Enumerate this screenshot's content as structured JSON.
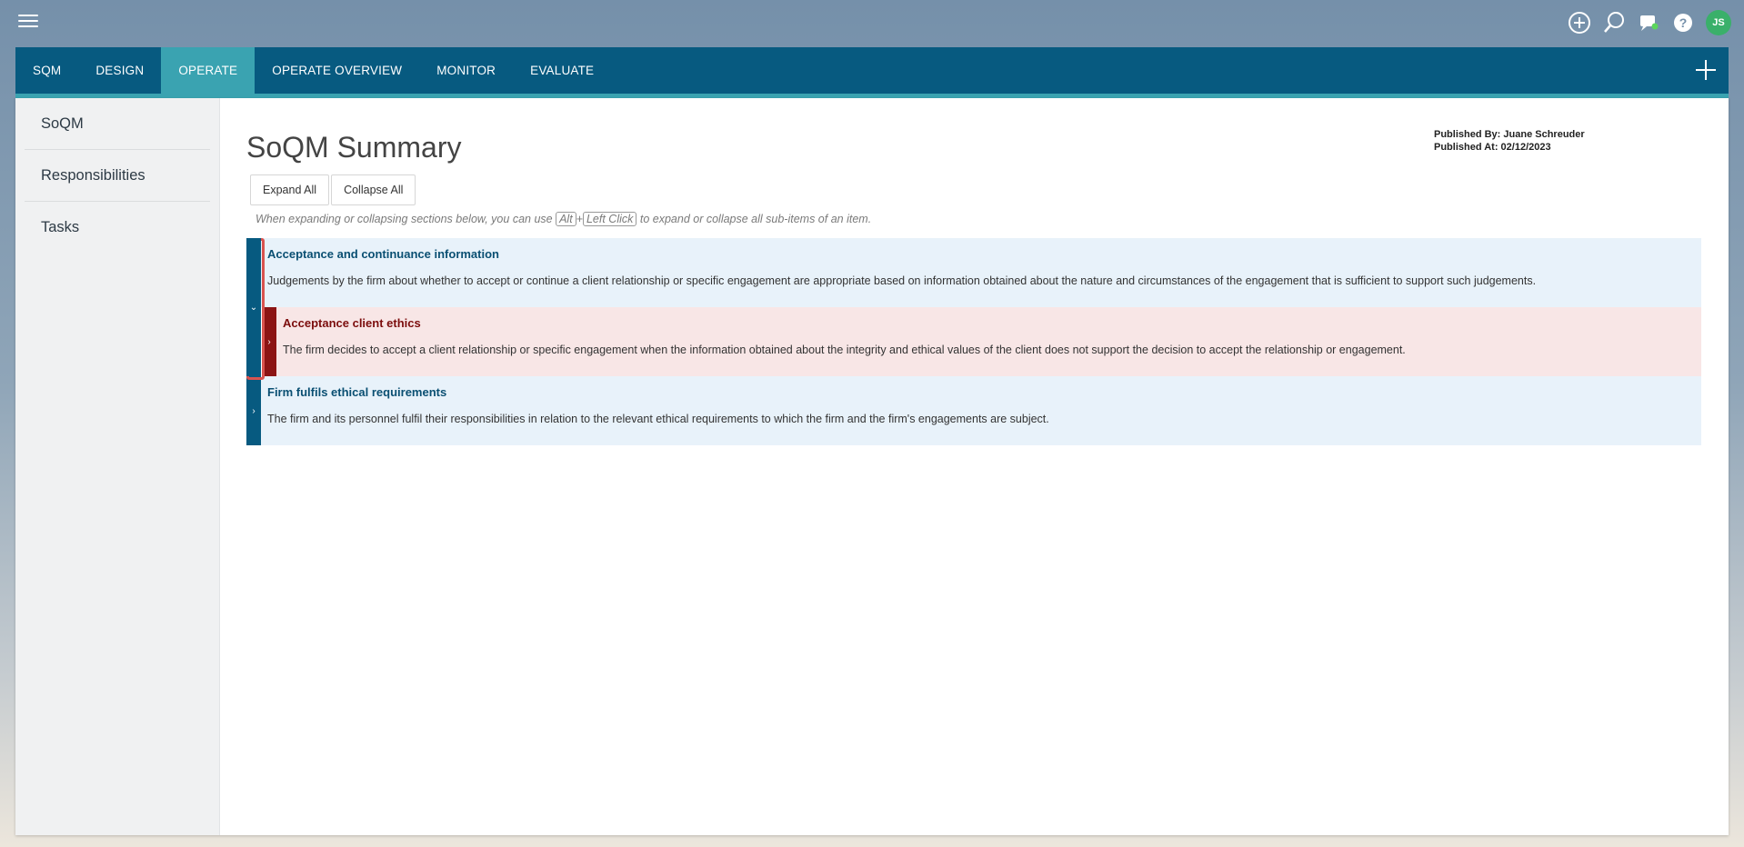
{
  "topbar": {
    "icons": [
      "add-circle-icon",
      "search-icon",
      "chat-icon",
      "help-icon"
    ],
    "avatar_initials": "JS"
  },
  "nav": {
    "tabs": [
      {
        "label": "SQM"
      },
      {
        "label": "DESIGN"
      },
      {
        "label": "OPERATE",
        "active": true
      },
      {
        "label": "OPERATE OVERVIEW"
      },
      {
        "label": "MONITOR"
      },
      {
        "label": "EVALUATE"
      }
    ]
  },
  "sidebar": {
    "items": [
      {
        "label": "SoQM"
      },
      {
        "label": "Responsibilities"
      },
      {
        "label": "Tasks"
      }
    ]
  },
  "main": {
    "title": "SoQM Summary",
    "published_by": "Published By: Juane Schreuder",
    "published_at": "Published At: 02/12/2023",
    "expand_all": "Expand All",
    "collapse_all": "Collapse All",
    "hint": {
      "before": "When expanding or collapsing sections below, you can use",
      "key1": "Alt",
      "plus": "+",
      "key2": "Left Click",
      "after": "to expand or collapse all sub-items of an item."
    },
    "items": [
      {
        "title": "Acceptance and continuance information",
        "description": "Judgements by the firm about whether to accept or continue a client relationship or specific engagement are appropriate based on information obtained about the nature and circumstances of the engagement that is sufficient to support such judgements.",
        "toggle": "⌄"
      },
      {
        "title": "Acceptance client ethics",
        "description": "The firm decides to accept a client relationship or specific engagement when the information obtained about the integrity and ethical values of the client does not support the decision to accept the relationship or engagement.",
        "toggle": "›"
      },
      {
        "title": "Firm fulfils ethical requirements",
        "description": "The firm and its personnel fulfil their responsibilities in relation to the relevant ethical requirements to which the firm and the firm's engagements are subject.",
        "toggle": "›"
      }
    ]
  },
  "colors": {
    "nav_bg": "#075a80",
    "nav_active": "#3aa3b1",
    "item_blue_bar": "#075a80",
    "item_red_bar": "#8c1414",
    "item_blue_bg": "#e8f2fa",
    "item_red_bg": "#f8e6e6"
  }
}
